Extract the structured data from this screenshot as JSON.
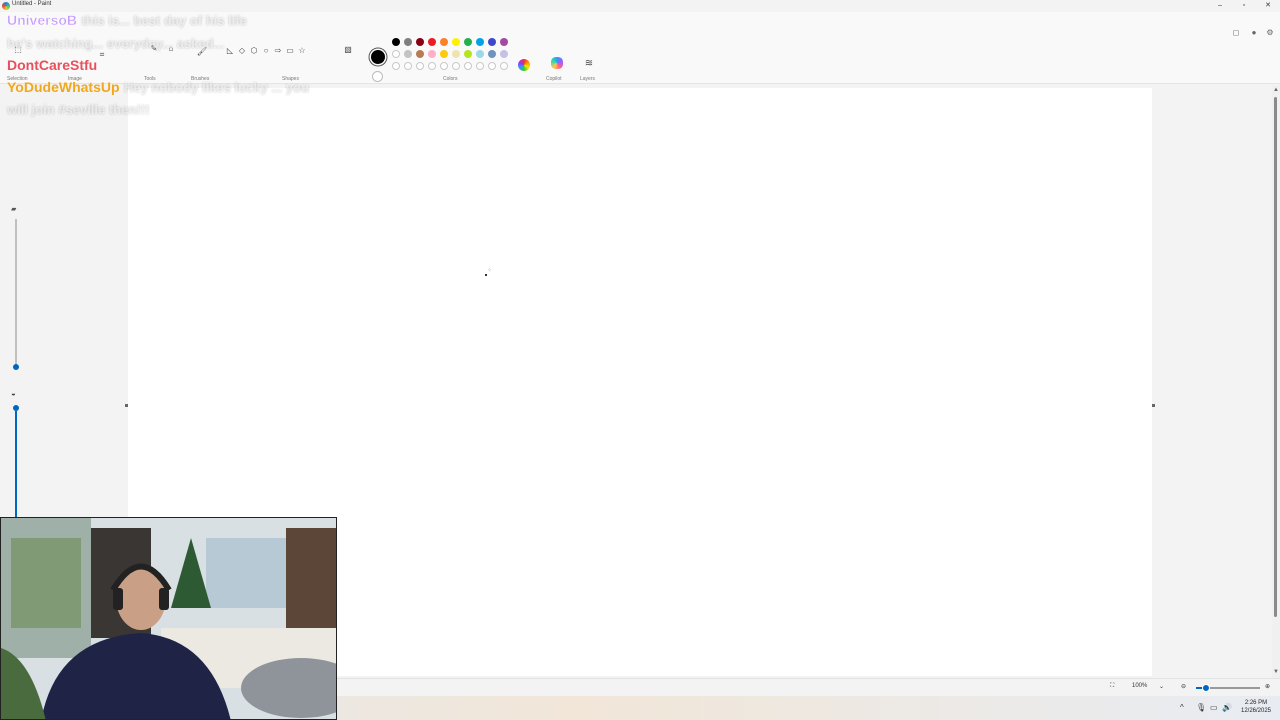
{
  "window": {
    "title": "Untitled - Paint",
    "minimize": "–",
    "maximize": "▫",
    "close": "✕"
  },
  "ribbon": {
    "groups": [
      {
        "label": "Selection"
      },
      {
        "label": "Image"
      },
      {
        "label": "Tools"
      },
      {
        "label": "Brushes"
      },
      {
        "label": "Shapes"
      },
      {
        "label": "Colors"
      },
      {
        "label": "Copilot"
      },
      {
        "label": "Layers"
      }
    ],
    "colors_row1": [
      "#000000",
      "#7f7f7f",
      "#880015",
      "#ed1c24",
      "#ff7f27",
      "#fff200",
      "#22b14c",
      "#00a2e8",
      "#3f48cc",
      "#a349a4"
    ],
    "colors_row2": [
      "#ffffff",
      "#c3c3c3",
      "#b97a57",
      "#ffaec9",
      "#ffc90e",
      "#efe4b0",
      "#b5e61d",
      "#99d9ea",
      "#7092be",
      "#c8bfe7"
    ],
    "current_color": "#000000"
  },
  "chat": [
    {
      "name": "UniversoB",
      "color": "#c59bff",
      "text": "this is... best day of his life"
    },
    {
      "name": "",
      "color": "",
      "text": "he's watching... everyday... asked..."
    },
    {
      "name": "DontCareStfu",
      "color": "#e8505b",
      "text": ""
    },
    {
      "name": "YoDudeWhatsUp",
      "color": "#f2a81d",
      "text": "Hey nobody likes lucky ... you"
    },
    {
      "name": "",
      "color": "",
      "text": "will join #seville then!!!"
    }
  ],
  "statusbar": {
    "zoom_value": "100%",
    "zoom_level": 0.15
  },
  "taskbar": {
    "time": "2:26 PM",
    "date": "12/26/2025"
  }
}
